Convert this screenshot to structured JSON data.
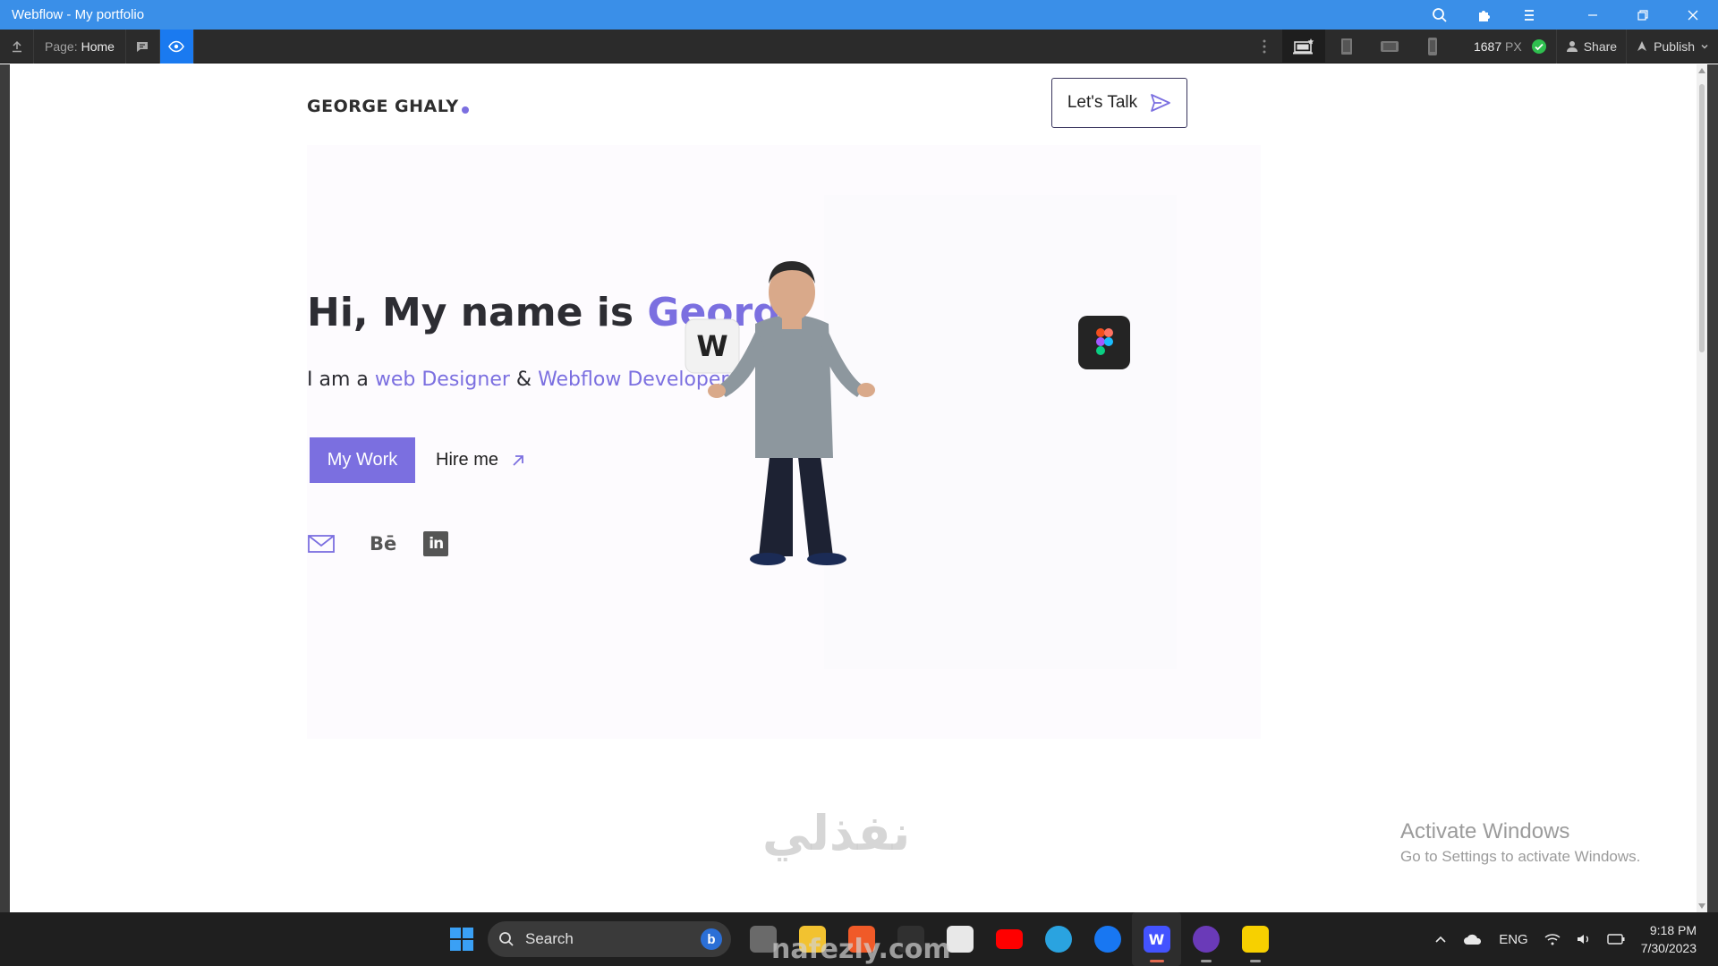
{
  "window": {
    "title": "Webflow - My portfolio"
  },
  "toolbar": {
    "page_label": "Page:",
    "page_value": "Home",
    "canvas_width": "1687",
    "canvas_unit": "PX",
    "share_label": "Share",
    "publish_label": "Publish"
  },
  "site": {
    "logo": "GEORGE GHALY",
    "cta_label": "Let's Talk",
    "heading_prefix": "Hi, My name is ",
    "heading_name": "George",
    "sub_prefix": "I am a ",
    "sub_role1": "web Designer",
    "sub_amp": " & ",
    "sub_role2": "Webflow Developer",
    "btn_work": "My Work",
    "btn_hire": "Hire me",
    "social_behance": "Bē",
    "social_linkedin": "in",
    "badge_webflow": "W"
  },
  "overlay": {
    "activate_title": "Activate Windows",
    "activate_sub": "Go to Settings to activate Windows.",
    "watermark_arabic": "نفذلي",
    "watermark_latin": "nafezly.com"
  },
  "taskbar": {
    "search_placeholder": "Search",
    "language": "ENG",
    "time": "9:18 PM",
    "date": "7/30/2023"
  },
  "colors": {
    "accent": "#7b6fe0",
    "titlebar": "#3a8fe8",
    "toolbar": "#2b2b2b",
    "preview_active": "#1a7af0"
  }
}
